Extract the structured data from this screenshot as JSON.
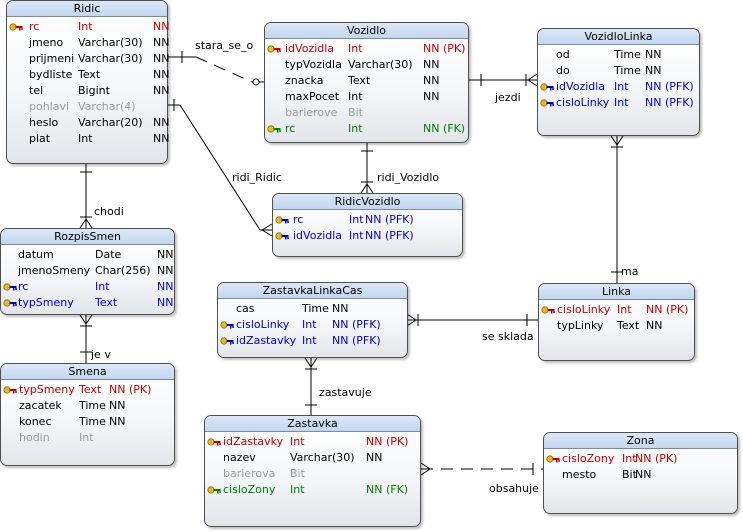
{
  "entities": {
    "ridic": {
      "name": "Ridic",
      "attrs": [
        {
          "name": "rc",
          "type": "Int",
          "flags": "NN",
          "kind": "pk"
        },
        {
          "name": "jmeno",
          "type": "Varchar(30)",
          "flags": "NN",
          "kind": "normal"
        },
        {
          "name": "prijmeni",
          "type": "Varchar(30)",
          "flags": "NN",
          "kind": "normal"
        },
        {
          "name": "bydliste",
          "type": "Text",
          "flags": "NN",
          "kind": "normal"
        },
        {
          "name": "tel",
          "type": "Bigint",
          "flags": "NN",
          "kind": "normal"
        },
        {
          "name": "pohlavi",
          "type": "Varchar(4)",
          "flags": "",
          "kind": "nullable"
        },
        {
          "name": "heslo",
          "type": "Varchar(20)",
          "flags": "NN",
          "kind": "normal"
        },
        {
          "name": "plat",
          "type": "Int",
          "flags": "NN",
          "kind": "normal"
        }
      ]
    },
    "vozidlo": {
      "name": "Vozidlo",
      "attrs": [
        {
          "name": "idVozidla",
          "type": "Int",
          "flags": "NN  (PK)",
          "kind": "pk"
        },
        {
          "name": "typVozidla",
          "type": "Varchar(30)",
          "flags": "NN",
          "kind": "normal"
        },
        {
          "name": "znacka",
          "type": "Text",
          "flags": "NN",
          "kind": "normal"
        },
        {
          "name": "maxPocet",
          "type": "Int",
          "flags": "NN",
          "kind": "normal"
        },
        {
          "name": "barierove",
          "type": "Bit",
          "flags": "",
          "kind": "nullable"
        },
        {
          "name": "rc",
          "type": "Int",
          "flags": "NN  (FK)",
          "kind": "fk"
        }
      ]
    },
    "vozidlolinka": {
      "name": "VozidloLinka",
      "attrs": [
        {
          "name": "od",
          "type": "Time",
          "flags": "NN",
          "kind": "normal"
        },
        {
          "name": "do",
          "type": "Time",
          "flags": "NN",
          "kind": "normal"
        },
        {
          "name": "idVozidla",
          "type": "Int",
          "flags": "NN  (PFK)",
          "kind": "pfk"
        },
        {
          "name": "cisloLinky",
          "type": "Int",
          "flags": "NN  (PFK)",
          "kind": "pfk"
        }
      ]
    },
    "ridicvozidlo": {
      "name": "RidicVozidlo",
      "attrs": [
        {
          "name": "rc",
          "type": "Int",
          "flags": "NN  (PFK)",
          "kind": "pfk"
        },
        {
          "name": "idVozidla",
          "type": "Int",
          "flags": "NN  (PFK)",
          "kind": "pfk"
        }
      ]
    },
    "rozpissmen": {
      "name": "RozpisSmen",
      "attrs": [
        {
          "name": "datum",
          "type": "Date",
          "flags": "NN",
          "kind": "normal"
        },
        {
          "name": "jmenoSmeny",
          "type": "Char(256)",
          "flags": "NN",
          "kind": "normal"
        },
        {
          "name": "rc",
          "type": "Int",
          "flags": "NN",
          "kind": "pfk"
        },
        {
          "name": "typSmeny",
          "type": "Text",
          "flags": "NN",
          "kind": "pfk"
        }
      ]
    },
    "smena": {
      "name": "Smena",
      "attrs": [
        {
          "name": "typSmeny",
          "type": "Text",
          "flags": "NN  (PK)",
          "kind": "pk"
        },
        {
          "name": "zacatek",
          "type": "Time",
          "flags": "NN",
          "kind": "normal"
        },
        {
          "name": "konec",
          "type": "Time",
          "flags": "NN",
          "kind": "normal"
        },
        {
          "name": "hodin",
          "type": "Int",
          "flags": "",
          "kind": "nullable"
        }
      ]
    },
    "zastavkalinkacas": {
      "name": "ZastavkaLinkaCas",
      "attrs": [
        {
          "name": "cas",
          "type": "Time",
          "flags": "NN",
          "kind": "normal"
        },
        {
          "name": "cisloLinky",
          "type": "Int",
          "flags": "NN  (PFK)",
          "kind": "pfk"
        },
        {
          "name": "idZastavky",
          "type": "Int",
          "flags": "NN  (PFK)",
          "kind": "pfk"
        }
      ]
    },
    "linka": {
      "name": "Linka",
      "attrs": [
        {
          "name": "cisloLinky",
          "type": "Int",
          "flags": "NN  (PK)",
          "kind": "pk"
        },
        {
          "name": "typLinky",
          "type": "Text",
          "flags": "NN",
          "kind": "normal"
        }
      ]
    },
    "zastavka": {
      "name": "Zastavka",
      "attrs": [
        {
          "name": "idZastavky",
          "type": "Int",
          "flags": "NN  (PK)",
          "kind": "pk"
        },
        {
          "name": "nazev",
          "type": "Varchar(30)",
          "flags": "NN",
          "kind": "normal"
        },
        {
          "name": "barierova",
          "type": "Bit",
          "flags": "",
          "kind": "nullable"
        },
        {
          "name": "cisloZony",
          "type": "Int",
          "flags": "NN  (FK)",
          "kind": "fk"
        }
      ]
    },
    "zona": {
      "name": "Zona",
      "attrs": [
        {
          "name": "cisloZony",
          "type": "Int",
          "flags": "NN  (PK)",
          "kind": "pk"
        },
        {
          "name": "mesto",
          "type": "Bit",
          "flags": "NN",
          "kind": "normal"
        }
      ]
    }
  },
  "relationships": {
    "stara_se_o": "stara_se_o",
    "jezdi": "jezdi",
    "ridi_ridic": "ridi_Ridic",
    "ridi_vozidlo": "ridi_Vozidlo",
    "chodi": "chodi",
    "je_v": "je v",
    "ma": "ma",
    "se_sklada": "se sklada",
    "zastavuje": "zastavuje",
    "obsahuje": "obsahuje"
  },
  "colors": {
    "pk": "#c00000",
    "pfk": "#0000cc",
    "fk": "#008000",
    "nullable": "#9a9a9a",
    "header": "#c4d6ee"
  }
}
